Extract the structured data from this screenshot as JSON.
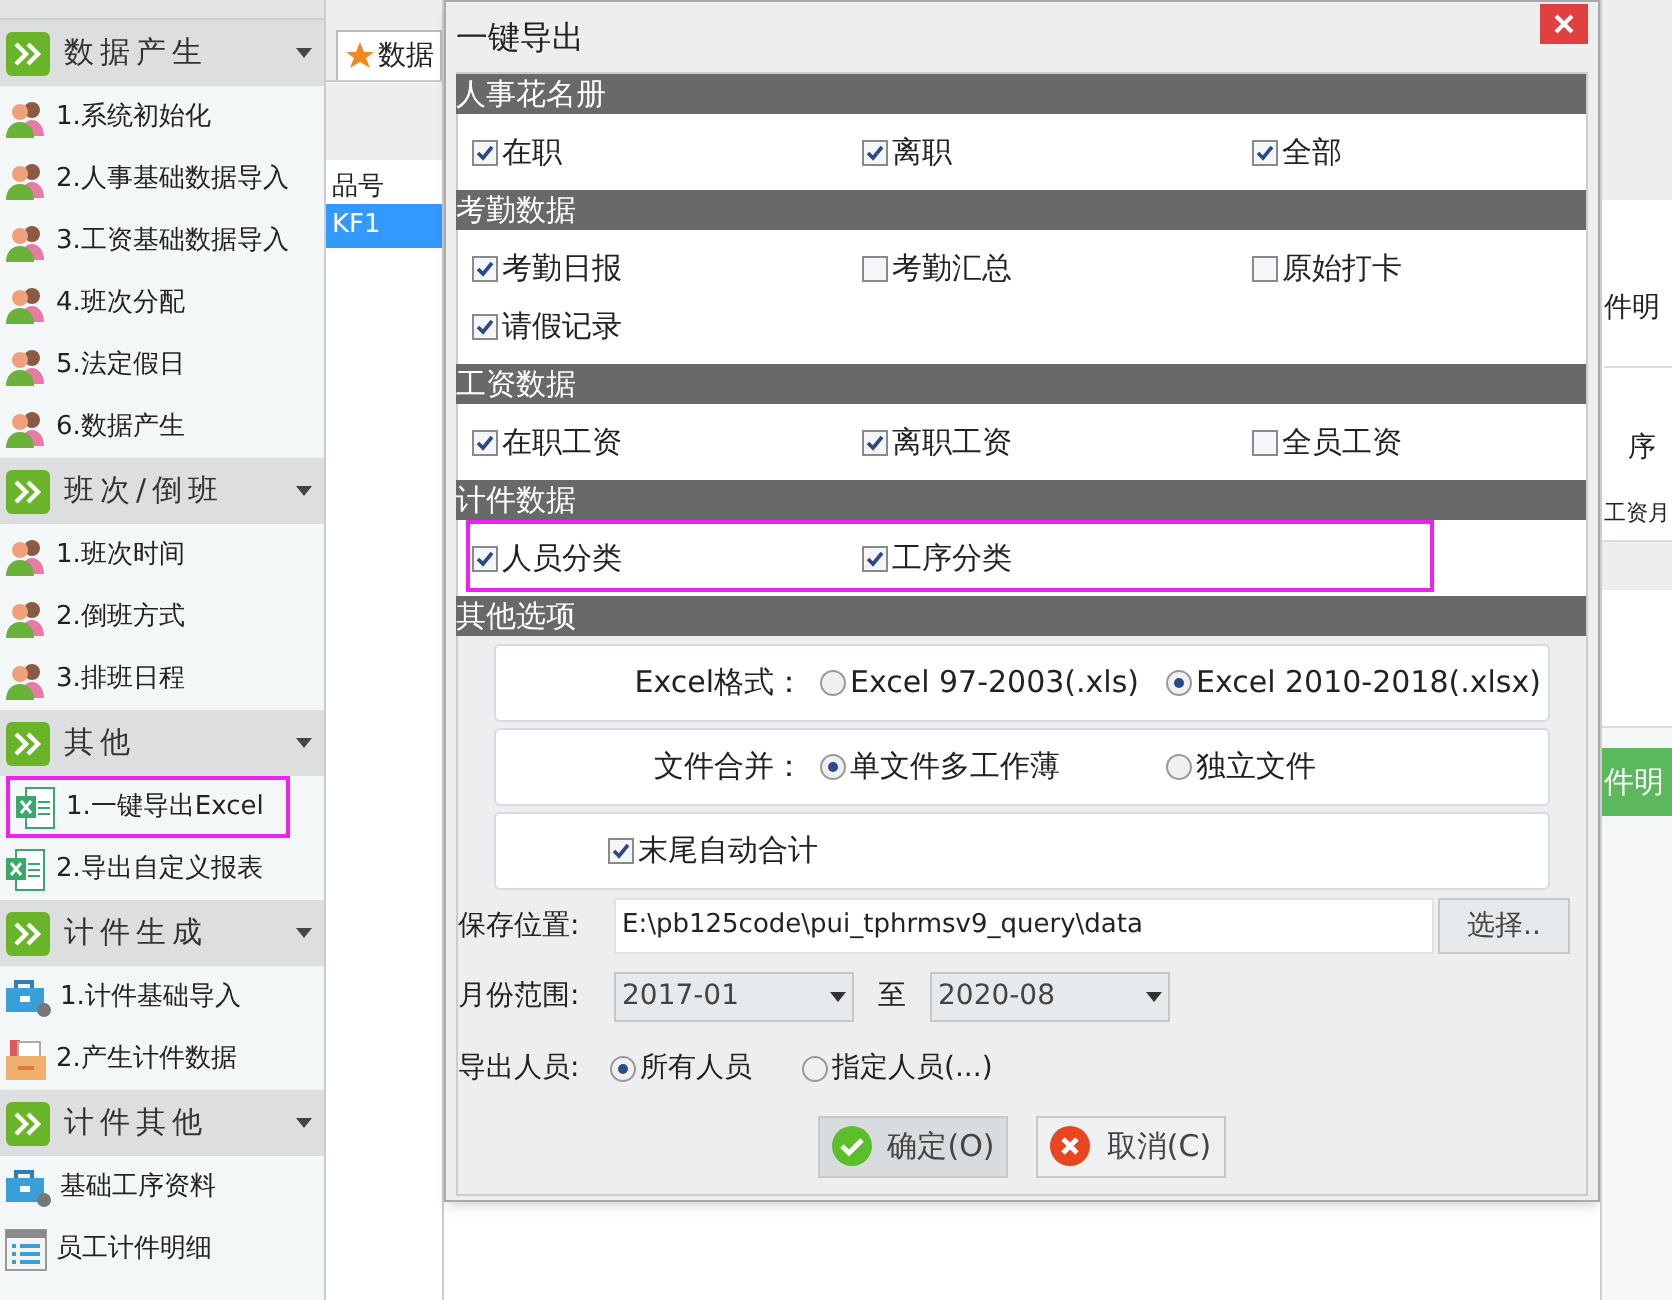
{
  "sidebar": {
    "groups": [
      {
        "title": "数据产生",
        "items": [
          {
            "label": "1.系统初始化",
            "kind": "person",
            "highlighted": false
          },
          {
            "label": "2.人事基础数据导入",
            "kind": "person",
            "highlighted": false
          },
          {
            "label": "3.工资基础数据导入",
            "kind": "person",
            "highlighted": false
          },
          {
            "label": "4.班次分配",
            "kind": "person",
            "highlighted": false
          },
          {
            "label": "5.法定假日",
            "kind": "person",
            "highlighted": false
          },
          {
            "label": "6.数据产生",
            "kind": "person",
            "highlighted": false
          }
        ]
      },
      {
        "title": "班次/倒班",
        "items": [
          {
            "label": "1.班次时间",
            "kind": "person",
            "highlighted": false
          },
          {
            "label": "2.倒班方式",
            "kind": "person",
            "highlighted": false
          },
          {
            "label": "3.排班日程",
            "kind": "person",
            "highlighted": false
          }
        ]
      },
      {
        "title": "其他",
        "items": [
          {
            "label": "1.一键导出Excel",
            "kind": "excel",
            "highlighted": true
          },
          {
            "label": "2.导出自定义报表",
            "kind": "excel",
            "highlighted": false
          }
        ]
      },
      {
        "title": "计件生成",
        "items": [
          {
            "label": "1.计件基础导入",
            "kind": "toolbox",
            "highlighted": false
          },
          {
            "label": "2.产生计件数据",
            "kind": "folder",
            "highlighted": false
          }
        ]
      },
      {
        "title": "计件其他",
        "items": [
          {
            "label": "基础工序资料",
            "kind": "toolbox",
            "highlighted": false
          },
          {
            "label": "员工计件明细",
            "kind": "list",
            "highlighted": false
          }
        ]
      }
    ]
  },
  "middle": {
    "tab": "数据",
    "table": {
      "columns": [
        "品号"
      ],
      "rows": [
        {
          "cells": [
            "KF1"
          ],
          "selected": true
        }
      ]
    }
  },
  "dialog": {
    "title": "一键导出",
    "sections": [
      {
        "title": "人事花名册",
        "highlighted": false,
        "options": [
          {
            "label": "在职",
            "checked": true
          },
          {
            "label": "离职",
            "checked": true
          },
          {
            "label": "全部",
            "checked": true
          }
        ]
      },
      {
        "title": "考勤数据",
        "highlighted": false,
        "options": [
          {
            "label": "考勤日报",
            "checked": true
          },
          {
            "label": "考勤汇总",
            "checked": false
          },
          {
            "label": "原始打卡",
            "checked": false
          },
          {
            "label": "请假记录",
            "checked": true
          }
        ]
      },
      {
        "title": "工资数据",
        "highlighted": false,
        "options": [
          {
            "label": "在职工资",
            "checked": true
          },
          {
            "label": "离职工资",
            "checked": true
          },
          {
            "label": "全员工资",
            "checked": false
          }
        ]
      },
      {
        "title": "计件数据",
        "highlighted": true,
        "options": [
          {
            "label": "人员分类",
            "checked": true
          },
          {
            "label": "工序分类",
            "checked": true
          }
        ]
      }
    ],
    "other": {
      "title": "其他选项",
      "format": {
        "label": "Excel格式：",
        "options": [
          {
            "label": "Excel 97-2003(.xls)",
            "selected": false
          },
          {
            "label": "Excel 2010-2018(.xlsx)",
            "selected": true
          }
        ]
      },
      "merge": {
        "label": "文件合并：",
        "options": [
          {
            "label": "单文件多工作薄",
            "selected": true
          },
          {
            "label": "独立文件",
            "selected": false
          }
        ]
      },
      "auto_sum": {
        "label": "末尾自动合计",
        "checked": true
      },
      "save": {
        "label": "保存位置:",
        "value": "E:\\pb125code\\pui_tphrmsv9_query\\data",
        "button": "选择.."
      },
      "month": {
        "label": "月份范围:",
        "from": "2017-01",
        "separator": "至",
        "to": "2020-08"
      },
      "export": {
        "label": "导出人员:",
        "options": [
          {
            "label": "所有人员",
            "selected": true
          },
          {
            "label": "指定人员(...)",
            "selected": false
          }
        ]
      }
    },
    "buttons": [
      {
        "label": "确定(O)",
        "kind": "ok"
      },
      {
        "label": "取消(C)",
        "kind": "cancel"
      }
    ]
  },
  "background": {
    "texts": [
      "件明",
      "序",
      "工资月"
    ],
    "button": "件明"
  }
}
